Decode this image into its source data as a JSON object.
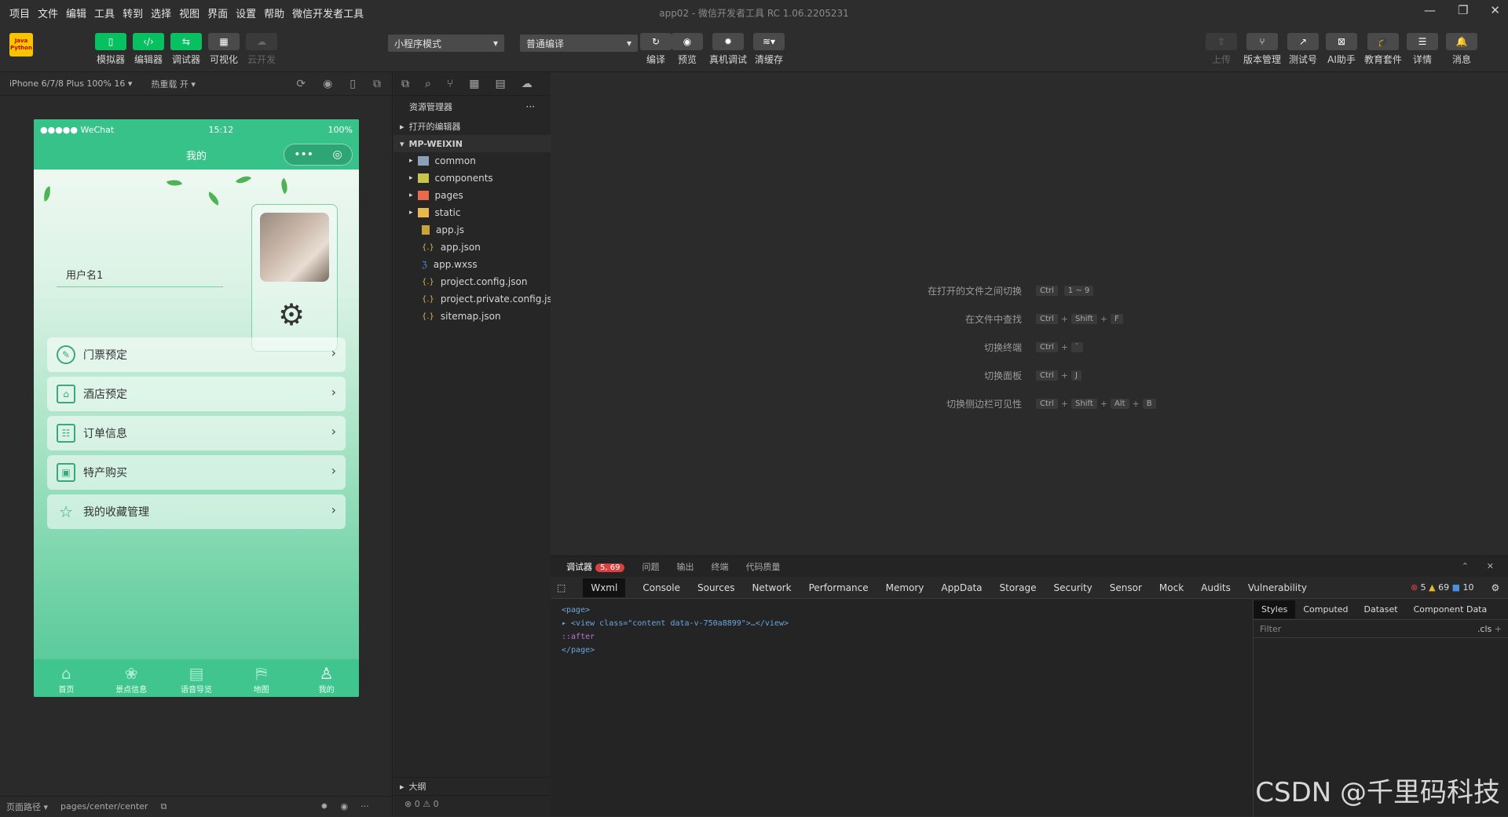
{
  "menubar": {
    "items": [
      "项目",
      "文件",
      "编辑",
      "工具",
      "转到",
      "选择",
      "视图",
      "界面",
      "设置",
      "帮助",
      "微信开发者工具"
    ],
    "title": "app02 - 微信开发者工具 RC 1.06.2205231"
  },
  "toolbar": {
    "logo_text": "Java Python",
    "left_buttons": [
      {
        "label": "模拟器",
        "icon": "phone-icon"
      },
      {
        "label": "编辑器",
        "icon": "code-icon"
      },
      {
        "label": "调试器",
        "icon": "debug-icon"
      },
      {
        "label": "可视化",
        "icon": "layout-icon"
      },
      {
        "label": "云开发",
        "icon": "cloud-icon"
      }
    ],
    "mode_select": "小程序模式",
    "compile_select": "普通编译",
    "center_buttons": [
      {
        "label": "编译",
        "icon": "refresh-icon"
      },
      {
        "label": "预览",
        "icon": "eye-icon"
      },
      {
        "label": "真机调试",
        "icon": "bug-icon"
      },
      {
        "label": "清缓存",
        "icon": "layers-icon"
      }
    ],
    "right_buttons": [
      {
        "label": "上传",
        "icon": "upload-icon"
      },
      {
        "label": "版本管理",
        "icon": "branch-icon"
      },
      {
        "label": "测试号",
        "icon": "external-icon"
      },
      {
        "label": "AI助手",
        "icon": "ai-icon"
      },
      {
        "label": "教育套件",
        "icon": "cap-icon"
      },
      {
        "label": "详情",
        "icon": "menu-icon"
      },
      {
        "label": "消息",
        "icon": "bell-icon"
      }
    ]
  },
  "simulator": {
    "device": "iPhone 6/7/8 Plus 100% 16 ▾",
    "hot_reload": "热重载 开 ▾",
    "status": {
      "carrier": "●●●●● WeChat",
      "time": "15:12",
      "battery": "100%"
    },
    "nav_title": "我的",
    "username": "用户名1",
    "menu": [
      "门票预定",
      "酒店预定",
      "订单信息",
      "特产购买",
      "我的收藏管理"
    ],
    "tabs": [
      {
        "label": "首页",
        "icon": "home-icon"
      },
      {
        "label": "景点信息",
        "icon": "grid-icon"
      },
      {
        "label": "语音导览",
        "icon": "audio-icon"
      },
      {
        "label": "地图",
        "icon": "map-icon"
      },
      {
        "label": "我的",
        "icon": "user-icon"
      }
    ],
    "footer": {
      "path_label": "页面路径 ▾",
      "path": "pages/center/center"
    }
  },
  "explorer": {
    "title": "资源管理器",
    "open_editors": "打开的编辑器",
    "project": "MP-WEIXIN",
    "folders": [
      "common",
      "components",
      "pages",
      "static"
    ],
    "files": [
      "app.js",
      "app.json",
      "app.wxss",
      "project.config.json",
      "project.private.config.js...",
      "sitemap.json"
    ],
    "outline": "大纲",
    "problems": "⊗ 0 ⚠ 0"
  },
  "editor": {
    "shortcuts": [
      {
        "label": "在打开的文件之间切换",
        "keys": [
          "Ctrl",
          "1 ~ 9"
        ]
      },
      {
        "label": "在文件中查找",
        "keys": [
          "Ctrl",
          "Shift",
          "F"
        ]
      },
      {
        "label": "切换终端",
        "keys": [
          "Ctrl",
          "`"
        ]
      },
      {
        "label": "切换面板",
        "keys": [
          "Ctrl",
          "J"
        ]
      },
      {
        "label": "切换侧边栏可见性",
        "keys": [
          "Ctrl",
          "Shift",
          "Alt",
          "B"
        ]
      }
    ]
  },
  "debugger": {
    "top_tabs": [
      "调试器",
      "问题",
      "输出",
      "终端",
      "代码质量"
    ],
    "badge": "5, 69",
    "tabs": [
      "Wxml",
      "Console",
      "Sources",
      "Network",
      "Performance",
      "Memory",
      "AppData",
      "Storage",
      "Security",
      "Sensor",
      "Mock",
      "Audits",
      "Vulnerability"
    ],
    "counts": {
      "errors": "5",
      "warnings": "69",
      "info": "10"
    },
    "wxml_lines": [
      "<page>",
      "▸ <view class=\"content data-v-750a8899\">…</view>",
      "  ::after",
      "</page>"
    ],
    "style_tabs": [
      "Styles",
      "Computed",
      "Dataset",
      "Component Data"
    ],
    "filter_placeholder": "Filter",
    "cls": ".cls"
  },
  "watermark": "CSDN @千里码科技"
}
